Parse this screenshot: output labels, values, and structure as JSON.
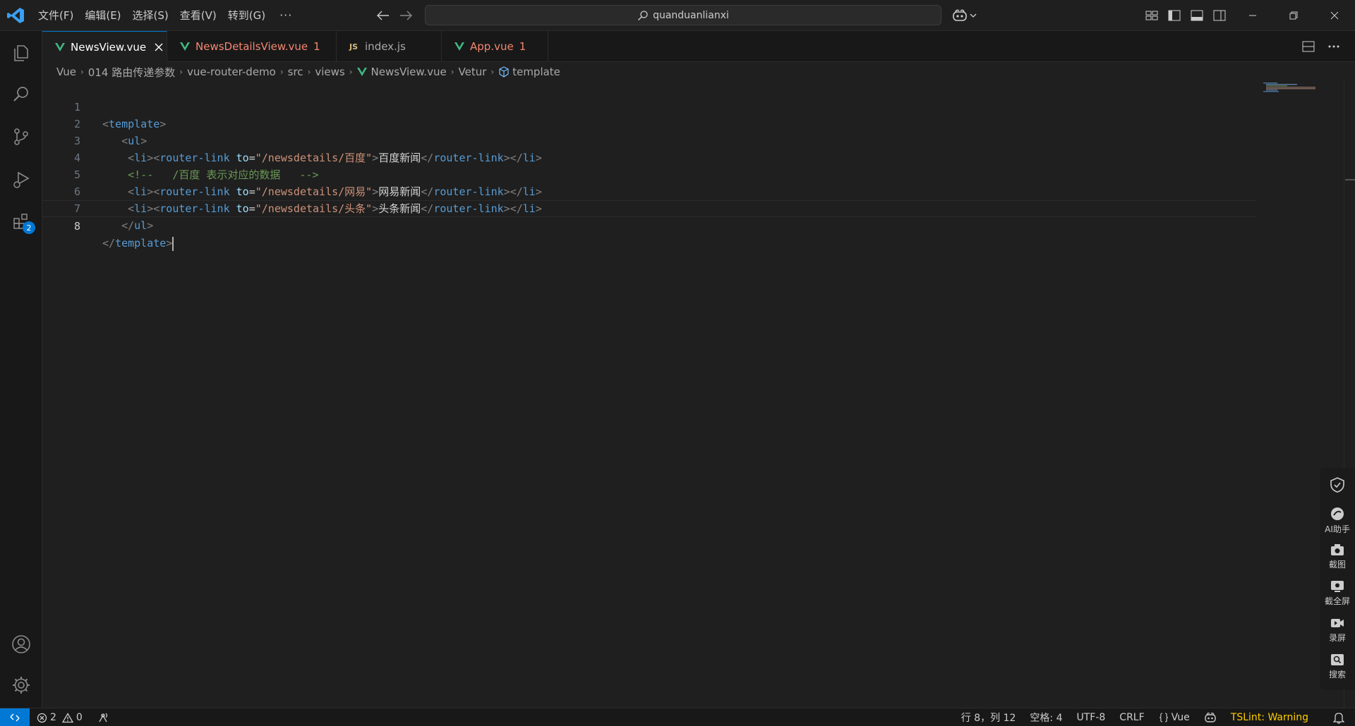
{
  "titlebar": {
    "menu": [
      "文件(F)",
      "编辑(E)",
      "选择(S)",
      "查看(V)",
      "转到(G)"
    ],
    "more": "···",
    "search_text": "quanduanlianxi"
  },
  "tabs": [
    {
      "label": "NewsView.vue",
      "badge": "",
      "kind": "vue",
      "active": true
    },
    {
      "label": "NewsDetailsView.vue",
      "badge": "1",
      "kind": "vue",
      "active": false
    },
    {
      "label": "index.js",
      "badge": "",
      "kind": "js",
      "active": false
    },
    {
      "label": "App.vue",
      "badge": "1",
      "kind": "vue",
      "active": false
    }
  ],
  "js_badge": "JS",
  "breadcrumb": [
    "Vue",
    "014 路由传递参数",
    "vue-router-demo",
    "src",
    "views",
    "NewsView.vue",
    "Vetur",
    "template"
  ],
  "extensions_badge": "2",
  "code": {
    "line_numbers": [
      "1",
      "2",
      "3",
      "4",
      "5",
      "6",
      "7",
      "8"
    ],
    "l1": {
      "open": "<",
      "tag": "template",
      "close": ">"
    },
    "l2": {
      "indent": "   ",
      "open": "<",
      "tag": "ul",
      "close": ">"
    },
    "l3": {
      "indent": "    ",
      "p1": "<",
      "li": "li",
      "p2": "><",
      "rl": "router-link",
      "sp": " ",
      "attr": "to",
      "eq": "=",
      "val": "\"/newsdetails/百度\"",
      "gt": ">",
      "text": "百度新闻",
      "c1": "</",
      "rl2": "router-link",
      "c2": "></",
      "li2": "li",
      "c3": ">"
    },
    "l4": {
      "indent": "    ",
      "comment": "<!--   /百度 表示对应的数据   -->"
    },
    "l5": {
      "indent": "    ",
      "p1": "<",
      "li": "li",
      "p2": "><",
      "rl": "router-link",
      "sp": " ",
      "attr": "to",
      "eq": "=",
      "val": "\"/newsdetails/网易\"",
      "gt": ">",
      "text": "网易新闻",
      "c1": "</",
      "rl2": "router-link",
      "c2": "></",
      "li2": "li",
      "c3": ">"
    },
    "l6": {
      "indent": "    ",
      "p1": "<",
      "li": "li",
      "p2": "><",
      "rl": "router-link",
      "sp": " ",
      "attr": "to",
      "eq": "=",
      "val": "\"/newsdetails/头条\"",
      "gt": ">",
      "text": "头条新闻",
      "c1": "</",
      "rl2": "router-link",
      "c2": "></",
      "li2": "li",
      "c3": ">"
    },
    "l7": {
      "indent": "   ",
      "open": "</",
      "tag": "ul",
      "close": ">"
    },
    "l8": {
      "open": "</",
      "tag": "template",
      "close": ">"
    }
  },
  "float_panel": {
    "ai": "AI助手",
    "shot": "截图",
    "fullshot": "截全屏",
    "record": "录屏",
    "search": "搜索"
  },
  "statusbar": {
    "errors": "2",
    "warnings": "0",
    "position": "行 8，列 12",
    "spaces": "空格: 4",
    "encoding": "UTF-8",
    "eol": "CRLF",
    "language": "Vue",
    "tslint": "TSLint: Warning"
  },
  "colors": {
    "accent": "#0078d4",
    "vue_green": "#41b883",
    "error": "#f48771",
    "warning": "#ffcc00"
  }
}
